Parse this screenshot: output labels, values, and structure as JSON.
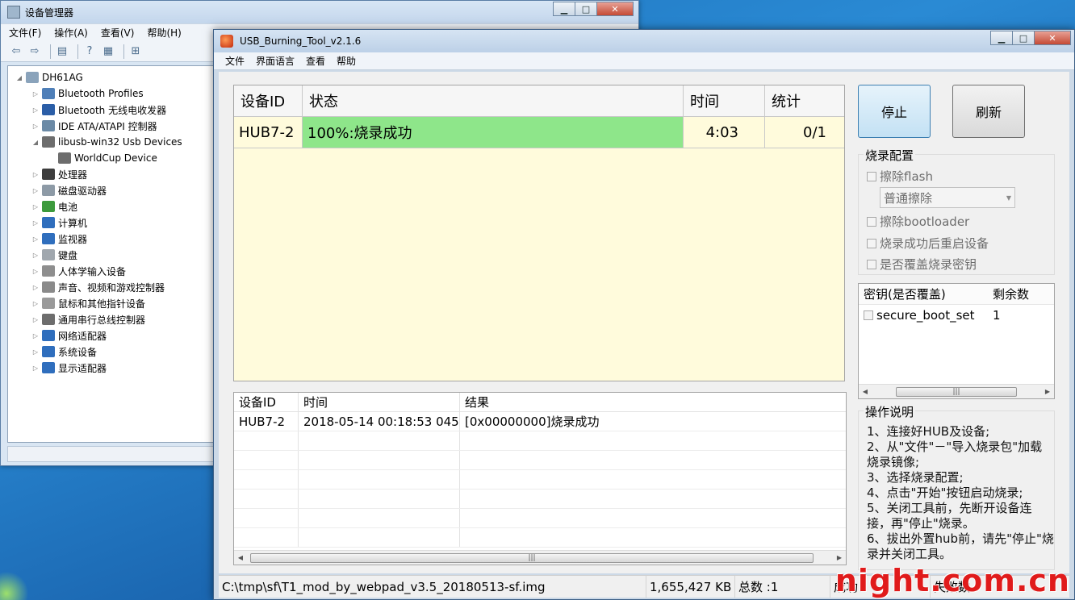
{
  "device_manager": {
    "title": "设备管理器",
    "menu": [
      "文件(F)",
      "操作(A)",
      "查看(V)",
      "帮助(H)"
    ],
    "tree": [
      {
        "label": "DH61AG",
        "level": 0,
        "expand": "◢",
        "icon_color": "#8aa3bb"
      },
      {
        "label": "Bluetooth Profiles",
        "level": 1,
        "expand": "▷",
        "icon_color": "#4f7fb8"
      },
      {
        "label": "Bluetooth 无线电收发器",
        "level": 1,
        "expand": "▷",
        "icon_color": "#2b5ea7"
      },
      {
        "label": "IDE ATA/ATAPI 控制器",
        "level": 1,
        "expand": "▷",
        "icon_color": "#6b8aa6"
      },
      {
        "label": "libusb-win32 Usb Devices",
        "level": 1,
        "expand": "◢",
        "icon_color": "#6d6d6d"
      },
      {
        "label": "WorldCup Device",
        "level": 2,
        "expand": "",
        "icon_color": "#6d6d6d"
      },
      {
        "label": "处理器",
        "level": 1,
        "expand": "▷",
        "icon_color": "#3d3d3d"
      },
      {
        "label": "磁盘驱动器",
        "level": 1,
        "expand": "▷",
        "icon_color": "#8d9aa6"
      },
      {
        "label": "电池",
        "level": 1,
        "expand": "▷",
        "icon_color": "#3c9a3c"
      },
      {
        "label": "计算机",
        "level": 1,
        "expand": "▷",
        "icon_color": "#2f6ebd"
      },
      {
        "label": "监视器",
        "level": 1,
        "expand": "▷",
        "icon_color": "#2f6ebd"
      },
      {
        "label": "键盘",
        "level": 1,
        "expand": "▷",
        "icon_color": "#a0a7ae"
      },
      {
        "label": "人体学输入设备",
        "level": 1,
        "expand": "▷",
        "icon_color": "#8e8e8e"
      },
      {
        "label": "声音、视频和游戏控制器",
        "level": 1,
        "expand": "▷",
        "icon_color": "#8a8a8a"
      },
      {
        "label": "鼠标和其他指针设备",
        "level": 1,
        "expand": "▷",
        "icon_color": "#9a9a9a"
      },
      {
        "label": "通用串行总线控制器",
        "level": 1,
        "expand": "▷",
        "icon_color": "#6d6d6d"
      },
      {
        "label": "网络适配器",
        "level": 1,
        "expand": "▷",
        "icon_color": "#2f6ebd"
      },
      {
        "label": "系统设备",
        "level": 1,
        "expand": "▷",
        "icon_color": "#2f6ebd"
      },
      {
        "label": "显示适配器",
        "level": 1,
        "expand": "▷",
        "icon_color": "#2f6ebd"
      }
    ]
  },
  "usb_tool": {
    "title": "USB_Burning_Tool_v2.1.6",
    "menu": [
      "文件",
      "界面语言",
      "查看",
      "帮助"
    ],
    "device_table": {
      "headers": [
        "设备ID",
        "状态",
        "时间",
        "统计"
      ],
      "rows": [
        {
          "id": "HUB7-2",
          "status": "100%:烧录成功",
          "time": "4:03",
          "stat": "0/1"
        }
      ]
    },
    "log_table": {
      "headers": [
        "设备ID",
        "时间",
        "结果"
      ],
      "rows": [
        {
          "id": "HUB7-2",
          "time": "2018-05-14 00:18:53 045",
          "result": "[0x00000000]烧录成功"
        }
      ]
    },
    "buttons": {
      "stop": "停止",
      "refresh": "刷新"
    },
    "config": {
      "title": "烧录配置",
      "erase_flash": "擦除flash",
      "erase_mode": "普通擦除",
      "erase_bootloader": "擦除bootloader",
      "reboot_after": "烧录成功后重启设备",
      "overwrite_key": "是否覆盖烧录密钥"
    },
    "key_table": {
      "headers": [
        "密钥(是否覆盖)",
        "剩余数"
      ],
      "rows": [
        {
          "name": "secure_boot_set",
          "count": "1"
        }
      ]
    },
    "guide": {
      "title": "操作说明",
      "lines": [
        "1、连接好HUB及设备;",
        "2、从\"文件\"－\"导入烧录包\"加载烧录镜像;",
        "3、选择烧录配置;",
        "4、点击\"开始\"按钮启动烧录;",
        "5、关闭工具前，先断开设备连接，再\"停止\"烧录。",
        "6、拔出外置hub前，请先\"停止\"烧录并关闭工具。"
      ]
    },
    "status_bar": {
      "path": "C:\\tmp\\sf\\T1_mod_by_webpad_v3.5_20180513-sf.img",
      "size": "1,655,427 KB",
      "total": "总数 :1",
      "success": "成功",
      "fail": "失败数"
    }
  },
  "watermark": "night.com.cn"
}
